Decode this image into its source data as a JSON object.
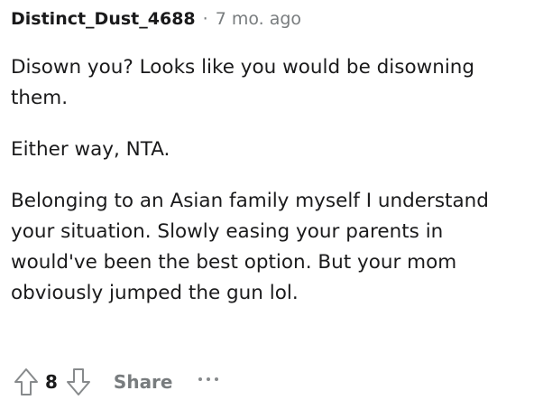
{
  "comment": {
    "author": "Distinct_Dust_4688",
    "separator": "·",
    "timestamp": "7 mo. ago",
    "paragraphs": [
      "Disown you? Looks like you would be disowning them.",
      "Either way, NTA.",
      "Belonging to an Asian family myself I understand your situation. Slowly easing your parents in would've been the best option. But your mom obviously jumped the gun lol."
    ]
  },
  "actions": {
    "upvote_icon": "arrow-up-outline-icon",
    "score": "8",
    "downvote_icon": "arrow-down-outline-icon",
    "share_label": "Share",
    "more_icon": "more-options-icon"
  },
  "colors": {
    "text": "#1a1a1b",
    "muted": "#787c7e",
    "icon": "#878a8c"
  }
}
